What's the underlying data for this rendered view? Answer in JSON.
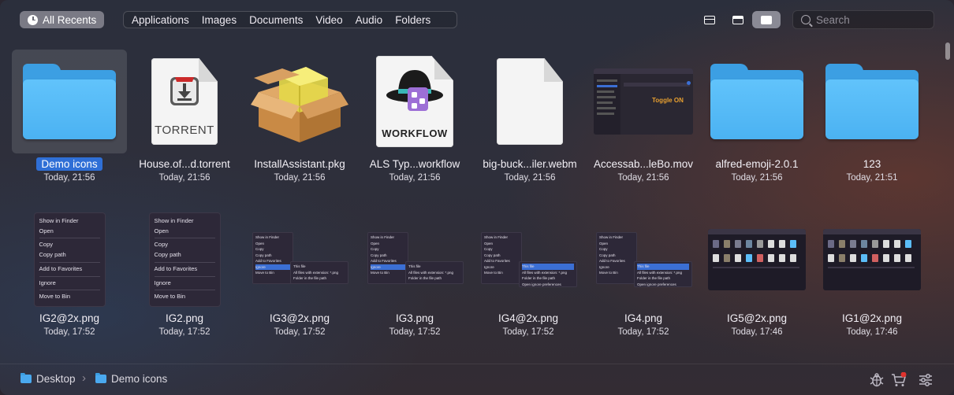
{
  "toolbar": {
    "recents_label": "All Recents",
    "filters": [
      "Applications",
      "Images",
      "Documents",
      "Video",
      "Audio",
      "Folders"
    ],
    "view_modes": [
      "list-view-icon",
      "split-view-icon",
      "grid-view-icon"
    ],
    "active_view": "grid-view-icon",
    "search_placeholder": "Search"
  },
  "items": [
    {
      "name": "Demo icons",
      "date": "Today, 21:56",
      "kind": "folder",
      "selected": true
    },
    {
      "name": "House.of...d.torrent",
      "date": "Today, 21:56",
      "kind": "torrent",
      "badge": "TORRENT"
    },
    {
      "name": "InstallAssistant.pkg",
      "date": "Today, 21:56",
      "kind": "package"
    },
    {
      "name": "ALS Typ...workflow",
      "date": "Today, 21:56",
      "kind": "workflow",
      "badge": "WORKFLOW"
    },
    {
      "name": "big-buck...iler.webm",
      "date": "Today, 21:56",
      "kind": "document"
    },
    {
      "name": "Accessab...leBo.mov",
      "date": "Today, 21:56",
      "kind": "video-thumb",
      "overlay": "Toggle ON"
    },
    {
      "name": "alfred-emoji-2.0.1",
      "date": "Today, 21:56",
      "kind": "folder"
    },
    {
      "name": "123",
      "date": "Today, 21:51",
      "kind": "folder"
    },
    {
      "name": "IG2@2x.png",
      "date": "Today, 17:52",
      "kind": "menu"
    },
    {
      "name": "IG2.png",
      "date": "Today, 17:52",
      "kind": "menu"
    },
    {
      "name": "IG3@2x.png",
      "date": "Today, 17:52",
      "kind": "submenu"
    },
    {
      "name": "IG3.png",
      "date": "Today, 17:52",
      "kind": "submenu"
    },
    {
      "name": "IG4@2x.png",
      "date": "Today, 17:52",
      "kind": "submenu-hl"
    },
    {
      "name": "IG4.png",
      "date": "Today, 17:52",
      "kind": "submenu-hl"
    },
    {
      "name": "IG5@2x.png",
      "date": "Today, 17:46",
      "kind": "app-shot"
    },
    {
      "name": "IG1@2x.png",
      "date": "Today, 17:46",
      "kind": "app-shot"
    }
  ],
  "context_menu": {
    "items": [
      "Show in Finder",
      "Open",
      "Copy",
      "Copy path",
      "Add to Favorites",
      "Ignore",
      "Move to Bin"
    ]
  },
  "submenu": {
    "items": [
      "This file",
      "All files with extension: *.png",
      "Folder in the file path",
      "Open ignore preferences"
    ]
  },
  "statusbar": {
    "path": [
      "Desktop",
      "Demo icons"
    ],
    "icons": [
      "bug-icon",
      "cart-icon",
      "settings-sliders-icon"
    ],
    "cart_badge_color": "#e0332e"
  },
  "colors": {
    "accent": "#2f6fd6",
    "folder": "#5bbdf8"
  }
}
